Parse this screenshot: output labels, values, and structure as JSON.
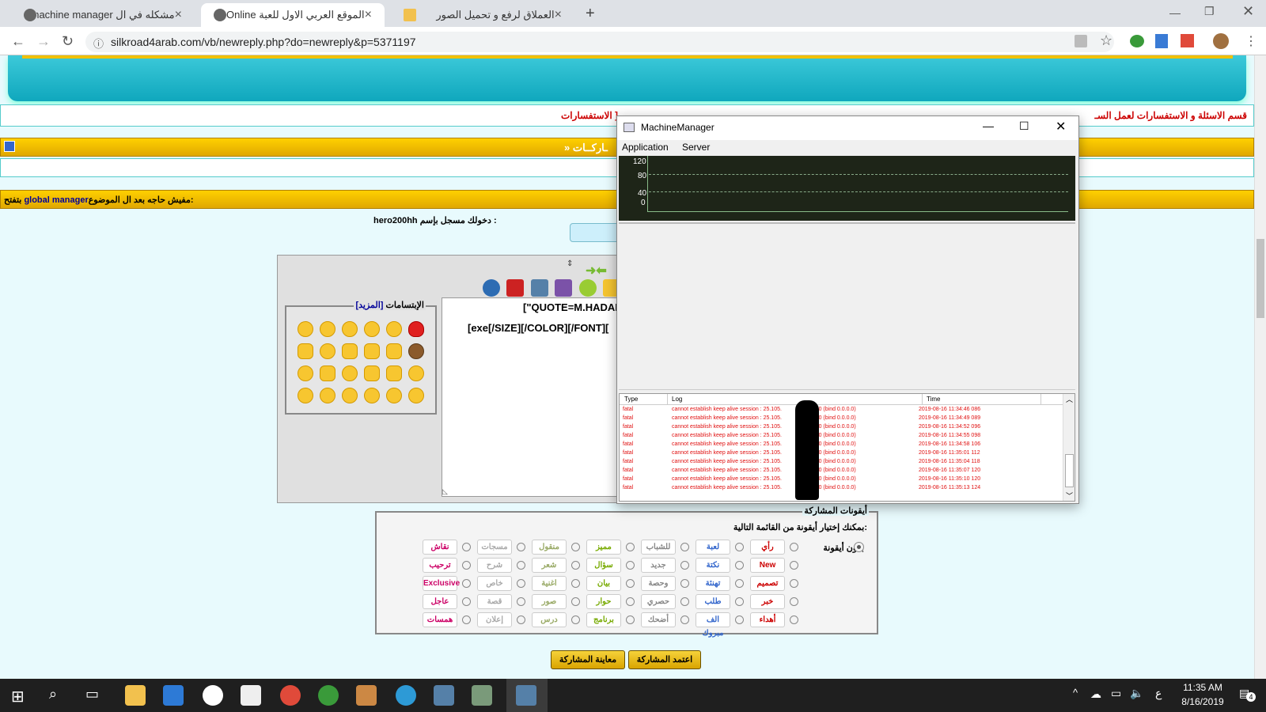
{
  "browser": {
    "tabs": [
      {
        "title": "مشكله في ال machine manager -",
        "close": "×"
      },
      {
        "title": "الموقع العربي الاول للعبة Online :",
        "close": "×"
      },
      {
        "title": "العملاق لرفع و تحميل الصور",
        "close": "×"
      }
    ],
    "new_tab": "+",
    "url": "silkroad4arab.com/vb/newreply.php?do=newreply&p=5371197"
  },
  "forum": {
    "section_line": "قسم الاسئلة و الاستفسارات لعمل السـ",
    "section_line_end": "الاستفسارات ]",
    "bar_text": "» ـاركــات",
    "subject_label": "الموضوع:",
    "subject_value": "مفيش حاجه بعد ال",
    "subject_bold": "global manager",
    "subject_end": "بتفتح",
    "logged_in": "دخولك مسجل بإسم :",
    "username": "hero200hh",
    "smilies_title": "الإبتسامات",
    "smilies_more": "[المزيد]",
    "editor_line1": "[\"QUOTE=M.HADAD",
    "editor_line2": "[exe[/SIZE][/COLOR][/FONT][",
    "icons_title": "أيقونات المشاركة",
    "icons_hint": "بمكنك إختيار أيقونة من القائمة التالية:",
    "no_icon": "بدون أيقونة",
    "submit": "اعتمد المشاركة",
    "preview": "معاينة المشاركة",
    "post_icons": [
      [
        "رأي",
        "لعبة",
        "للشباب",
        "مميز",
        "منقول",
        "مسجات",
        "نقاش"
      ],
      [
        "New",
        "نكتة",
        "جديد",
        "سؤال",
        "شعر",
        "شرح",
        "ترحيب"
      ],
      [
        "تصميم",
        "تهنئة",
        "وحصة",
        "بيان",
        "اغنية",
        "خاص",
        "Exclusive"
      ],
      [
        "خبر",
        "طلب",
        "حصري",
        "حوار",
        "صور",
        "قصة",
        "عاجل"
      ],
      [
        "أهداء",
        "الف مبروك",
        "أضحك",
        "برنامج",
        "درس",
        "إعلان",
        "همسات"
      ]
    ]
  },
  "machine_manager": {
    "title": "MachineManager",
    "menu": [
      "Application",
      "Server"
    ],
    "y_ticks": [
      "120",
      "80",
      "40",
      "0"
    ],
    "log_headers": [
      "Type",
      "Log",
      "Time"
    ],
    "log_rows": [
      [
        "fatal",
        "cannot establish keep alive session : 25.105.",
        "15880 (bind 0.0.0.0)",
        "2019-08-16 11:34:46 086"
      ],
      [
        "fatal",
        "cannot establish keep alive session : 25.105.",
        "15880 (bind 0.0.0.0)",
        "2019-08-16 11:34:49 089"
      ],
      [
        "fatal",
        "cannot establish keep alive session : 25.105.",
        "15880 (bind 0.0.0.0)",
        "2019-08-16 11:34:52 096"
      ],
      [
        "fatal",
        "cannot establish keep alive session : 25.105.",
        "15880 (bind 0.0.0.0)",
        "2019-08-16 11:34:55 098"
      ],
      [
        "fatal",
        "cannot establish keep alive session : 25.105.",
        "15880 (bind 0.0.0.0)",
        "2019-08-16 11:34:58 106"
      ],
      [
        "fatal",
        "cannot establish keep alive session : 25.105.",
        "15880 (bind 0.0.0.0)",
        "2019-08-16 11:35:01 112"
      ],
      [
        "fatal",
        "cannot establish keep alive session : 25.105.",
        "15880 (bind 0.0.0.0)",
        "2019-08-16 11:35:04 118"
      ],
      [
        "fatal",
        "cannot establish keep alive session : 25.105.",
        "15880 (bind 0.0.0.0)",
        "2019-08-16 11:35:07 120"
      ],
      [
        "fatal",
        "cannot establish keep alive session : 25.105.",
        "15880 (bind 0.0.0.0)",
        "2019-08-16 11:35:10 120"
      ],
      [
        "fatal",
        "cannot establish keep alive session : 25.105.",
        "15880 (bind 0.0.0.0)",
        "2019-08-16 11:35:13 124"
      ]
    ]
  },
  "taskbar": {
    "time": "11:35 AM",
    "date": "8/16/2019",
    "lang": "ع",
    "notif_count": "4"
  },
  "colors": {
    "yellow_bar": "#f0c000",
    "page_bg": "#e8fafd",
    "chart_bg": "#1e2518",
    "log_red": "#e01010"
  }
}
